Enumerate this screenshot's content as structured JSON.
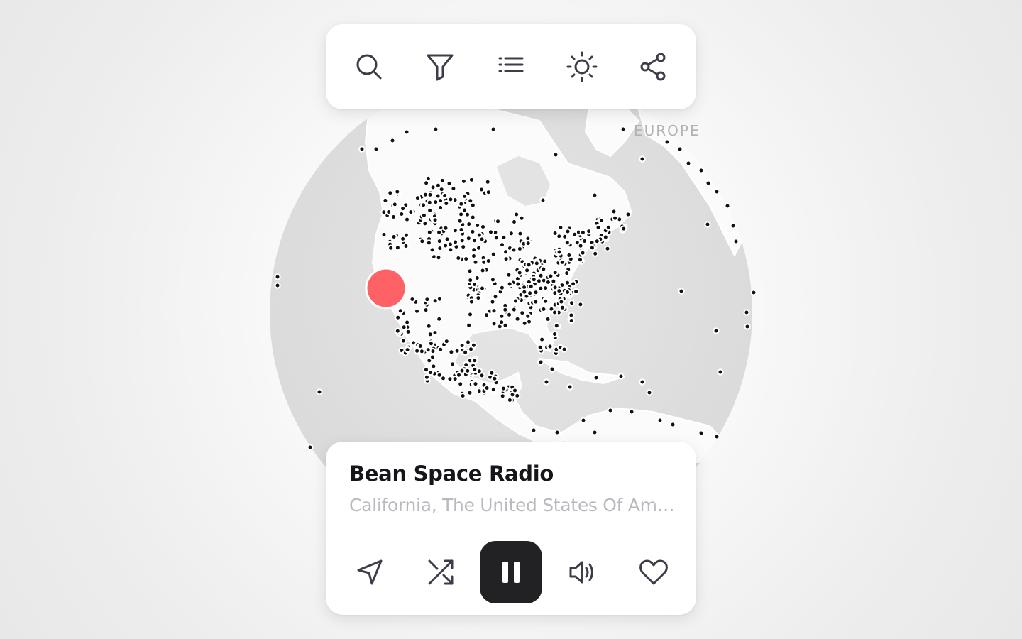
{
  "map": {
    "region_label": "EUROPE",
    "selected_marker_color": "#ff6266",
    "station_dot_color": "#111111"
  },
  "toolbar": {
    "buttons": [
      {
        "icon": "search-icon"
      },
      {
        "icon": "filter-icon"
      },
      {
        "icon": "list-icon"
      },
      {
        "icon": "brightness-icon"
      },
      {
        "icon": "share-icon"
      }
    ]
  },
  "player": {
    "station_name": "Bean Space Radio",
    "station_location": "California, The United States Of America",
    "state": "playing",
    "controls": [
      {
        "icon": "navigate-icon"
      },
      {
        "icon": "shuffle-icon"
      },
      {
        "icon": "pause-icon"
      },
      {
        "icon": "volume-icon"
      },
      {
        "icon": "heart-icon"
      }
    ]
  },
  "colors": {
    "icon": "#3d3d4a",
    "play_button_bg": "#222224",
    "location_text": "#b9b9bf"
  }
}
